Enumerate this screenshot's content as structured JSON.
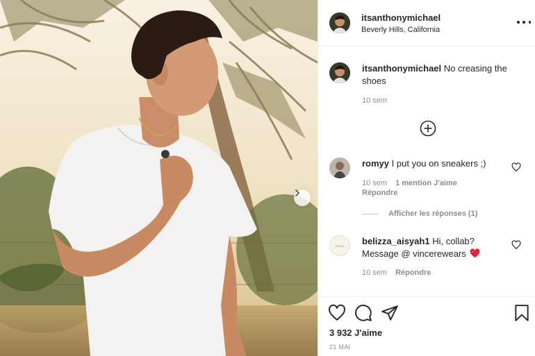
{
  "post": {
    "username": "itsanthonymichael",
    "location": "Beverly Hills, California"
  },
  "caption": {
    "username": "itsanthonymichael",
    "text": "No creasing the shoes",
    "time": "10 sem"
  },
  "comments": [
    {
      "username": "romyy",
      "text": "I put you on sneakers ;)",
      "time": "10 sem",
      "likes": "1 mention J'aime",
      "reply": "Répondre",
      "view_replies": "Afficher les réponses (1)"
    },
    {
      "username": "belizza_aisyah1",
      "text": "Hi, collab? Message @ vincerewears",
      "emoji": "❤️",
      "time": "10 sem",
      "reply": "Répondre"
    }
  ],
  "footer": {
    "likes": "3 932 J'aime",
    "date": "21 MAI"
  },
  "colors": {
    "text": "#262626",
    "muted": "#8e8e8e",
    "border": "#efefef",
    "heart_red": "#ed4956"
  },
  "icons": [
    "more-options-icon",
    "add-circle-icon",
    "heart-icon",
    "comment-icon",
    "share-icon",
    "bookmark-icon",
    "chevron-right-icon"
  ]
}
